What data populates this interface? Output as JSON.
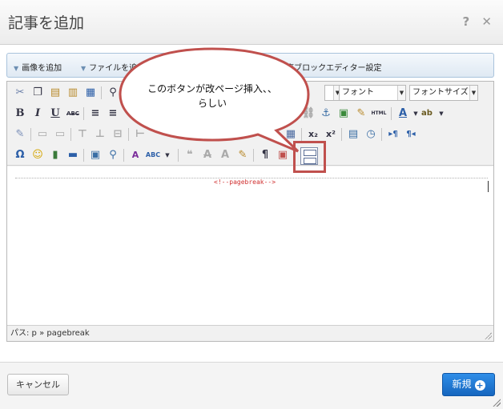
{
  "dialog": {
    "title": "記事を追加",
    "help_glyph": "?",
    "close_glyph": "✕"
  },
  "media_bar": {
    "items": [
      "画像を追加",
      "ファイルを追加",
      "記事ブロックエディター設定"
    ]
  },
  "toolbar": {
    "font_dropdown": "フォント",
    "font_size_dropdown": "フォントサイズ",
    "html_label": "HTML"
  },
  "editor": {
    "pagebreak_text": "<!--pagebreak-->",
    "path_text": "パス: p » pagebreak"
  },
  "callout": {
    "text_line1": "このボタンが改ページ挿入、、",
    "text_line2": "らしい"
  },
  "footer": {
    "cancel_label": "キャンセル",
    "new_label": "新規"
  },
  "colors": {
    "primary_button": "#1b6fca",
    "annotation": "#c0504d",
    "pagebreak_text": "#d03030"
  }
}
